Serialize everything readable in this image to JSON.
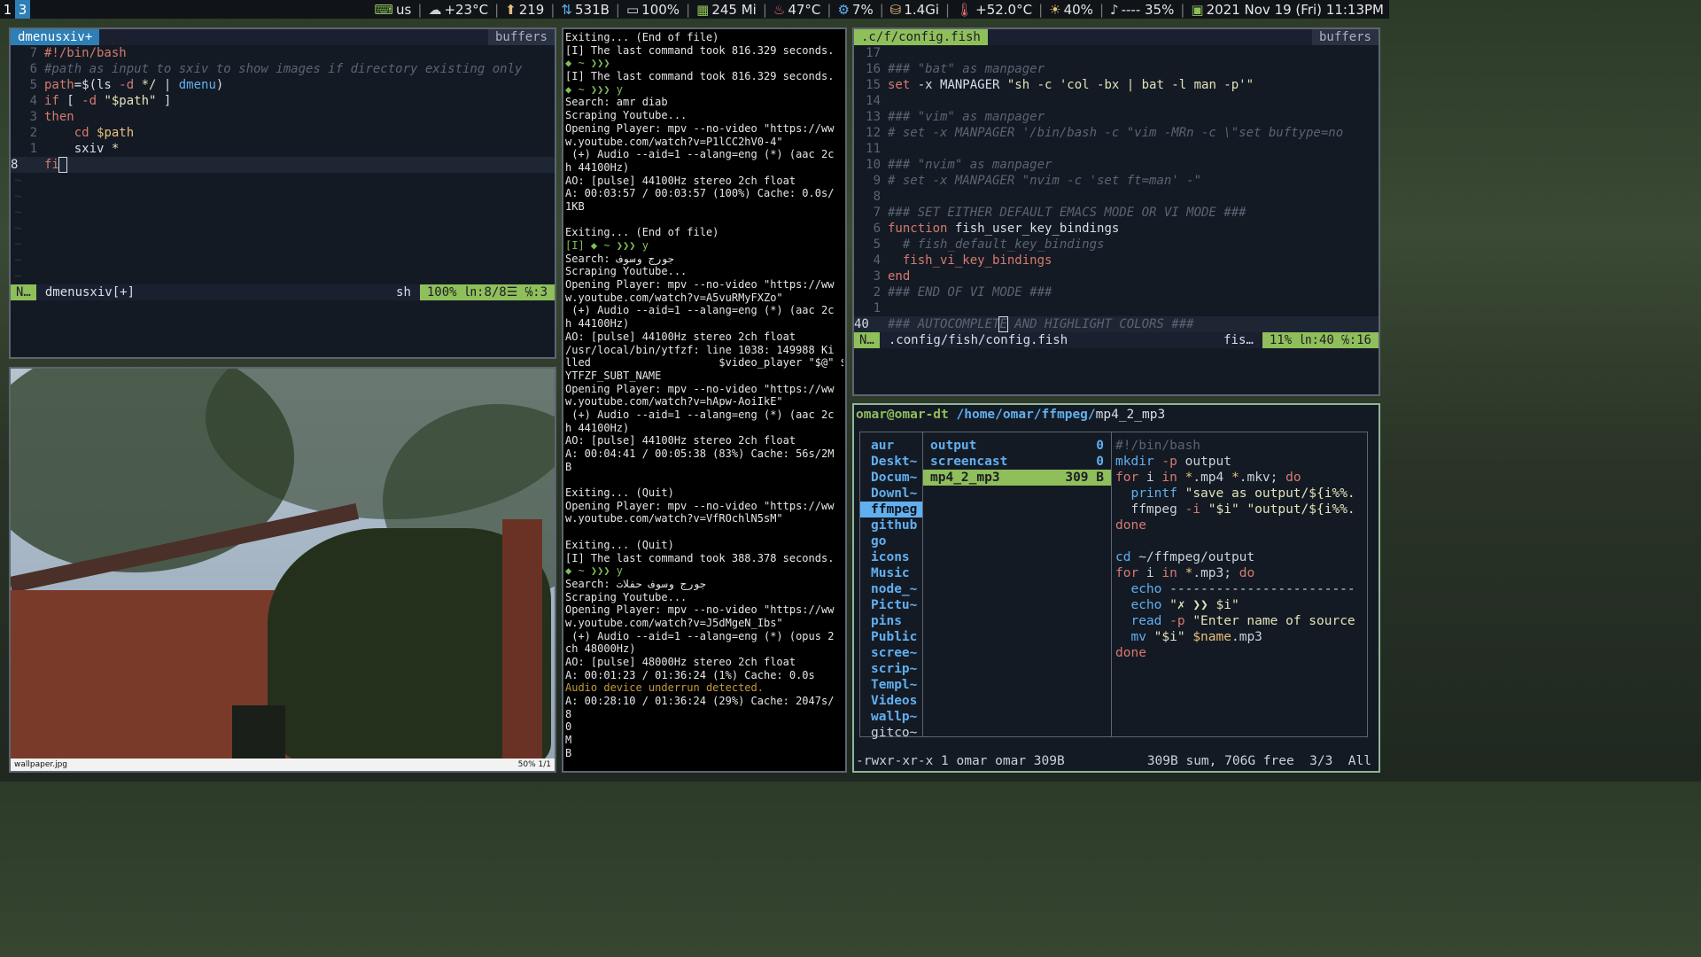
{
  "topbar": {
    "workspaces": [
      "1",
      "3"
    ],
    "active_workspace": "3",
    "status": [
      {
        "icon": "keyboard-icon",
        "text": "us"
      },
      {
        "icon": "weather-icon",
        "text": "+23°C"
      },
      {
        "icon": "updates-icon",
        "text": "219"
      },
      {
        "icon": "network-icon",
        "text": "531B"
      },
      {
        "icon": "battery-icon",
        "text": "100%"
      },
      {
        "icon": "memory-icon",
        "text": "245 Mi"
      },
      {
        "icon": "temperature-icon",
        "text": "47°C"
      },
      {
        "icon": "cpu-icon",
        "text": "7%"
      },
      {
        "icon": "disk-icon",
        "text": "1.4Gi"
      },
      {
        "icon": "thermometer-icon",
        "text": "+52.0°C"
      },
      {
        "icon": "brightness-icon",
        "text": "40%"
      },
      {
        "icon": "volume-icon",
        "text": "---- 35%"
      },
      {
        "icon": "calendar-icon",
        "text": "2021 Nov 19 (Fri) 11:13PM"
      }
    ]
  },
  "vim1": {
    "tab": "dmenusxiv+",
    "buffers": "buffers",
    "lines": [
      {
        "num": "7",
        "html": "<span class='c-kw'>#!/bin/bash</span>"
      },
      {
        "num": "6",
        "html": "<span class='c-cmt'>#path as input to sxiv to show images if directory existing only</span>"
      },
      {
        "num": "5",
        "html": "<span class='c-kw'>path</span><span class='c-plain'>=$(ls </span><span class='c-kw'>-d</span><span class='c-plain'> </span><span class='c-str'>*/</span><span class='c-plain'> | </span><span class='c-fn'>dmenu</span><span class='c-plain'>)</span>"
      },
      {
        "num": "4",
        "html": "<span class='c-kw'>if</span><span class='c-plain'> [ </span><span class='c-kw'>-d</span><span class='c-plain'> </span><span class='c-str'>\"$path\"</span><span class='c-plain'> ]</span>"
      },
      {
        "num": "3",
        "html": "<span class='c-kw'>then</span>"
      },
      {
        "num": "2",
        "html": "<span class='c-plain'>    </span><span class='c-kw'>cd</span><span class='c-plain'> </span><span class='c-var'>$path</span>"
      },
      {
        "num": "1",
        "html": "<span class='c-plain'>    sxiv </span><span class='c-str'>*</span>"
      },
      {
        "num": "8",
        "html": "<span class='c-kw'>fi</span><span class='c-plain' style='outline:1px solid #d8dee9'> </span>",
        "current": true
      }
    ],
    "status_mode": "N…",
    "status_file": "dmenusxiv[+]",
    "status_ft": "sh",
    "status_pos": "100% ㏑:8/8☰ ℅:3"
  },
  "vim2": {
    "tab": ".c/f/config.fish",
    "buffers": "buffers",
    "lines": [
      {
        "num": "17",
        "html": ""
      },
      {
        "num": "16",
        "html": "<span class='c-cmt'>### \"bat\" as manpager</span>"
      },
      {
        "num": "15",
        "html": "<span class='c-kw'>set</span><span class='c-plain'> -x MANPAGER </span><span class='c-str'>\"sh -c 'col -bx | bat -l man -p'\"</span>"
      },
      {
        "num": "14",
        "html": ""
      },
      {
        "num": "13",
        "html": "<span class='c-cmt'>### \"vim\" as manpager</span>"
      },
      {
        "num": "12",
        "html": "<span class='c-cmt'># set -x MANPAGER '/bin/bash -c \"vim -MRn -c \\\"set buftype=no</span>"
      },
      {
        "num": "11",
        "html": ""
      },
      {
        "num": "10",
        "html": "<span class='c-cmt'>### \"nvim\" as manpager</span>"
      },
      {
        "num": "9",
        "html": "<span class='c-cmt'># set -x MANPAGER \"nvim -c 'set ft=man' -\"</span>"
      },
      {
        "num": "8",
        "html": ""
      },
      {
        "num": "7",
        "html": "<span class='c-cmt'>### SET EITHER DEFAULT EMACS MODE OR VI MODE ###</span>"
      },
      {
        "num": "6",
        "html": "<span class='c-kw'>function</span><span class='c-plain'> fish_user_key_bindings</span>"
      },
      {
        "num": "5",
        "html": "<span class='c-cmt'>  # fish_default_key_bindings</span>"
      },
      {
        "num": "4",
        "html": "<span class='c-plain'>  </span><span class='c-kw'>fish_vi_key_bindings</span>"
      },
      {
        "num": "3",
        "html": "<span class='c-kw'>end</span>"
      },
      {
        "num": "2",
        "html": "<span class='c-cmt'>### END OF VI MODE ###</span>"
      },
      {
        "num": "1",
        "html": ""
      },
      {
        "num": "40",
        "html": "<span class='c-cmt'>### AUTOCOMPLET</span><span class='c-cmt' style='outline:1px solid #d8dee9'>E</span><span class='c-cmt'> AND HIGHLIGHT COLORS ###</span>",
        "current": true
      }
    ],
    "status_mode": "N…",
    "status_file": ".config/fish/config.fish",
    "status_ft": "fis…",
    "status_pos": "11% ㏑:40 ℅:16"
  },
  "terminal": {
    "lines": [
      {
        "t": "Exiting... (End of file)"
      },
      {
        "t": "[I] The last command took 816.329 seconds."
      },
      {
        "t": "◆ ~ ❯❯❯",
        "cls": "t-green"
      },
      {
        "t": "[I] The last command took 816.329 seconds."
      },
      {
        "t": "◆ ~ ❯❯❯ y",
        "cls": "t-green"
      },
      {
        "t": "Search: amr diab"
      },
      {
        "t": "Scraping Youtube..."
      },
      {
        "t": "Opening Player: mpv --no-video \"https://ww"
      },
      {
        "t": "w.youtube.com/watch?v=P1lCC2hV0-4\""
      },
      {
        "t": " (+) Audio --aid=1 --alang=eng (*) (aac 2c"
      },
      {
        "t": "h 44100Hz)"
      },
      {
        "t": "AO: [pulse] 44100Hz stereo 2ch float"
      },
      {
        "t": "A: 00:03:57 / 00:03:57 (100%) Cache: 0.0s/"
      },
      {
        "t": "1KB"
      },
      {
        "t": ""
      },
      {
        "t": "Exiting... (End of file)"
      },
      {
        "t": "[I] ◆ ~ ❯❯❯ y",
        "cls": "t-green"
      },
      {
        "t": "Search: جورج وسوف"
      },
      {
        "t": "Scraping Youtube..."
      },
      {
        "t": "Opening Player: mpv --no-video \"https://ww"
      },
      {
        "t": "w.youtube.com/watch?v=A5vuRMyFXZo\""
      },
      {
        "t": " (+) Audio --aid=1 --alang=eng (*) (aac 2c"
      },
      {
        "t": "h 44100Hz)"
      },
      {
        "t": "AO: [pulse] 44100Hz stereo 2ch float"
      },
      {
        "t": "/usr/local/bin/ytfzf: line 1038: 149988 Ki"
      },
      {
        "t": "lled                    $video_player \"$@\" $"
      },
      {
        "t": "YTFZF_SUBT_NAME"
      },
      {
        "t": "Opening Player: mpv --no-video \"https://ww"
      },
      {
        "t": "w.youtube.com/watch?v=hApw-AoiIkE\""
      },
      {
        "t": " (+) Audio --aid=1 --alang=eng (*) (aac 2c"
      },
      {
        "t": "h 44100Hz)"
      },
      {
        "t": "AO: [pulse] 44100Hz stereo 2ch float"
      },
      {
        "t": "A: 00:04:41 / 00:05:38 (83%) Cache: 56s/2M"
      },
      {
        "t": "B"
      },
      {
        "t": ""
      },
      {
        "t": "Exiting... (Quit)"
      },
      {
        "t": "Opening Player: mpv --no-video \"https://ww"
      },
      {
        "t": "w.youtube.com/watch?v=VfROchlN5sM\""
      },
      {
        "t": ""
      },
      {
        "t": "Exiting... (Quit)"
      },
      {
        "t": "[I] The last command took 388.378 seconds."
      },
      {
        "t": "◆ ~ ❯❯❯ y",
        "cls": "t-green"
      },
      {
        "t": "Search: جورج وسوف حفلات"
      },
      {
        "t": "Scraping Youtube..."
      },
      {
        "t": "Opening Player: mpv --no-video \"https://ww"
      },
      {
        "t": "w.youtube.com/watch?v=J5dMgeN_Ibs\""
      },
      {
        "t": " (+) Audio --aid=1 --alang=eng (*) (opus 2"
      },
      {
        "t": "ch 48000Hz)"
      },
      {
        "t": "AO: [pulse] 48000Hz stereo 2ch float"
      },
      {
        "t": "A: 00:01:23 / 01:36:24 (1%) Cache: 0.0s"
      },
      {
        "t": "Audio device underrun detected.",
        "cls": "t-warn"
      },
      {
        "t": "A: 00:28:10 / 01:36:24 (29%) Cache: 2047s/"
      },
      {
        "t": "8"
      },
      {
        "t": "0"
      },
      {
        "t": "M"
      },
      {
        "t": "B"
      }
    ]
  },
  "lf": {
    "user": "omar@omar-dt",
    "path": "/home/omar/ffmpeg/",
    "current": "mp4_2_mp3",
    "parent_items": [
      {
        "name": "aur"
      },
      {
        "name": "Deskt~"
      },
      {
        "name": "Docum~"
      },
      {
        "name": "Downl~"
      },
      {
        "name": "ffmpeg",
        "sel": true
      },
      {
        "name": "github"
      },
      {
        "name": "go"
      },
      {
        "name": "icons"
      },
      {
        "name": "Music"
      },
      {
        "name": "node_~"
      },
      {
        "name": "Pictu~"
      },
      {
        "name": "pins"
      },
      {
        "name": "Public"
      },
      {
        "name": "scree~"
      },
      {
        "name": "scrip~"
      },
      {
        "name": "Templ~"
      },
      {
        "name": "Videos"
      },
      {
        "name": "wallp~"
      },
      {
        "name": "gitco~",
        "plain": true
      }
    ],
    "files": [
      {
        "name": "output",
        "size": "0"
      },
      {
        "name": "screencast",
        "size": "0"
      },
      {
        "name": "mp4_2_mp3",
        "size": "309 B",
        "sel": true
      }
    ],
    "preview": [
      "<span class='c-cmt' style='font-style:normal'>#!/bin/bash</span>",
      "<span class='c-fn'>mkdir</span> <span class='c-kw'>-p</span> output",
      "<span class='c-kw'>for</span> i <span class='c-kw'>in</span> <span class='c-var'>*</span>.mp4 <span class='c-var'>*</span>.mkv; <span class='c-kw'>do</span>",
      "  <span class='c-fn'>printf</span> <span class='c-str'>\"save as output/${i%%.</span>",
      "  ffmpeg <span class='c-kw'>-i</span> <span class='c-str'>\"$i\"</span> <span class='c-str'>\"output/${i%%.</span>",
      "<span class='c-kw'>done</span>",
      "",
      "<span class='c-fn'>cd</span> ~/ffmpeg/output",
      "<span class='c-kw'>for</span> i <span class='c-kw'>in</span> <span class='c-var'>*</span>.mp3; <span class='c-kw'>do</span>",
      "  <span class='c-fn'>echo</span> ------------------------",
      "  <span class='c-fn'>echo</span> <span class='c-str'>\"✗ ❯❯ $i\"</span>",
      "  <span class='c-fn'>read</span> <span class='c-kw'>-p</span> <span class='c-str'>\"Enter name of source</span>",
      "  <span class='c-fn'>mv</span> <span class='c-str'>\"$i\"</span> <span class='c-var'>$name</span>.mp3",
      "<span class='c-kw'>done</span>"
    ],
    "status_left": "-rwxr-xr-x 1 omar omar 309B",
    "status_right": "309B sum, 706G free  3/3  All"
  },
  "sxiv": {
    "filename": "wallpaper.jpg",
    "info": "50%  1/1"
  }
}
